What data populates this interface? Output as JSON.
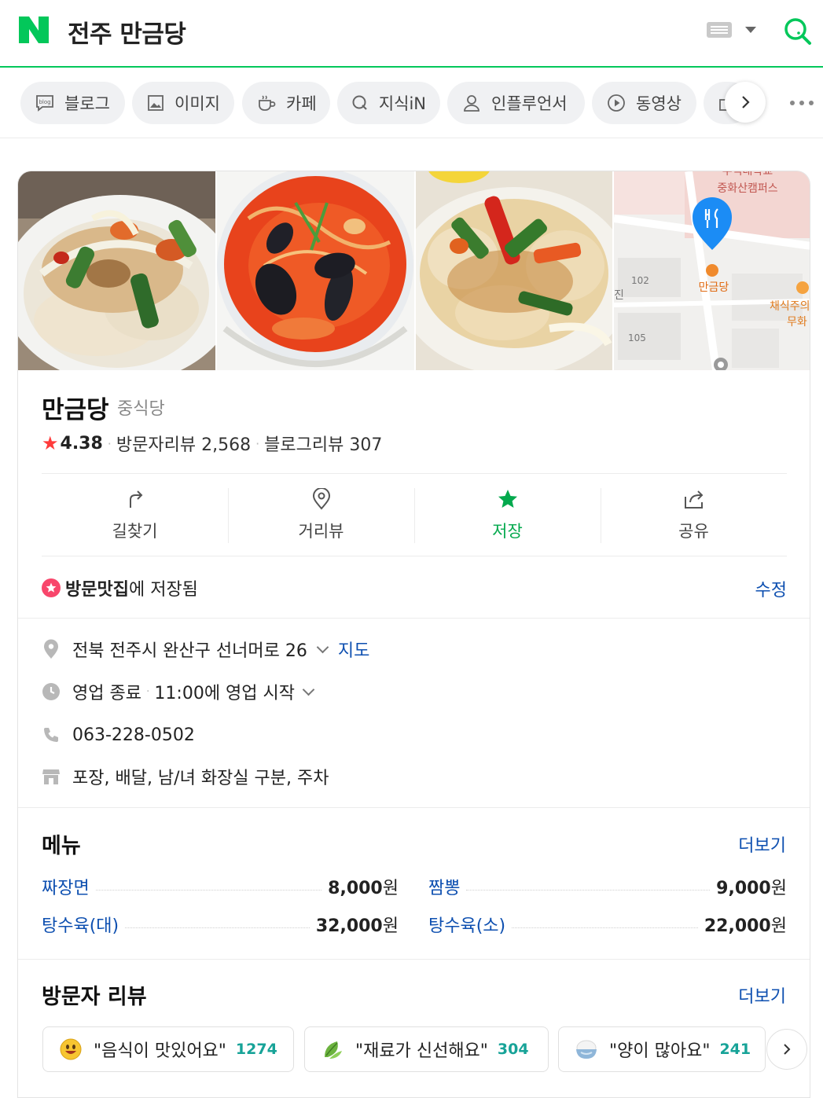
{
  "header": {
    "logo_letter": "N",
    "query": "전주 만금당",
    "brand_color": "#03c75a"
  },
  "tabs": [
    {
      "label": "블로그",
      "icon": "blog-icon"
    },
    {
      "label": "이미지",
      "icon": "image-icon"
    },
    {
      "label": "카페",
      "icon": "cafe-icon"
    },
    {
      "label": "지식iN",
      "icon": "kin-icon"
    },
    {
      "label": "인플루언서",
      "icon": "person-icon"
    },
    {
      "label": "동영상",
      "icon": "play-icon"
    }
  ],
  "place": {
    "name": "만금당",
    "category": "중식당",
    "rating": "4.38",
    "visitor_reviews_label": "방문자리뷰 2,568",
    "blog_reviews_label": "블로그리뷰 307"
  },
  "map": {
    "labels": {
      "campus_top": "우석대학교",
      "campus": "중화산캠퍼스",
      "place": "만금당",
      "n102": "102",
      "n105": "105",
      "jin": "진",
      "neighbor1": "채식주의",
      "neighbor2": "무화"
    }
  },
  "actions": [
    {
      "label": "길찾기",
      "icon": "directions-icon"
    },
    {
      "label": "거리뷰",
      "icon": "street-view-icon"
    },
    {
      "label": "저장",
      "icon": "star-icon"
    },
    {
      "label": "공유",
      "icon": "share-icon"
    }
  ],
  "saved": {
    "list_name": "방문맛집",
    "suffix": "에 저장됨",
    "edit_label": "수정"
  },
  "info": {
    "address": "전북 전주시 완산구 선너머로 26",
    "map_link": "지도",
    "status": "영업 종료",
    "hours": "11:00에 영업 시작",
    "phone": "063-228-0502",
    "amenities": "포장, 배달, 남/녀 화장실 구분, 주차"
  },
  "menu": {
    "title": "메뉴",
    "more_label": "더보기",
    "currency": "원",
    "items": [
      {
        "name": "짜장면",
        "price": "8,000"
      },
      {
        "name": "짬뽕",
        "price": "9,000"
      },
      {
        "name": "탕수육(대)",
        "price": "32,000"
      },
      {
        "name": "탕수육(소)",
        "price": "22,000"
      }
    ]
  },
  "reviews": {
    "title": "방문자 리뷰",
    "more_label": "더보기",
    "keywords": [
      {
        "text": "\"음식이 맛있어요\"",
        "count": "1274",
        "icon": "smile-emoji-icon"
      },
      {
        "text": "\"재료가 신선해요\"",
        "count": "304",
        "icon": "leaf-emoji-icon"
      },
      {
        "text": "\"양이 많아요\"",
        "count": "241",
        "icon": "rice-bowl-emoji-icon"
      }
    ]
  }
}
